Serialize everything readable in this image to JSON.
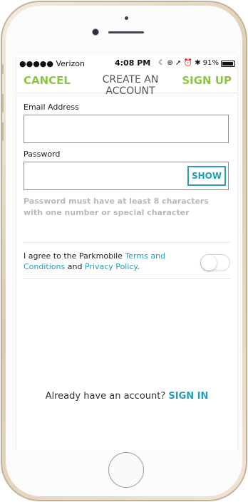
{
  "status_bar": {
    "carrier": "●●●●● Verizon",
    "time": "4:08 PM",
    "indicators": "☾ ⊕ ➚ ⏰ ✱ 91%",
    "battery_level": 0.91
  },
  "nav": {
    "cancel_label": "CANCEL",
    "title": "CREATE AN ACCOUNT",
    "signup_label": "SIGN UP"
  },
  "form": {
    "email_label": "Email Address",
    "email_value": "",
    "password_label": "Password",
    "password_value": "",
    "show_label": "SHOW",
    "password_hint": "Password must have at least 8 characters with one number or special character"
  },
  "agreement": {
    "prefix": "I agree to the Parkmobile ",
    "terms_link": "Terms and Conditions",
    "middle": " and ",
    "privacy_link": "Privacy Policy",
    "suffix": ".",
    "toggle_on": false
  },
  "footer": {
    "prompt": "Already have an account? ",
    "signin_label": "SIGN IN"
  },
  "colors": {
    "accent_green": "#8cc63f",
    "link_teal": "#2a9db4"
  }
}
